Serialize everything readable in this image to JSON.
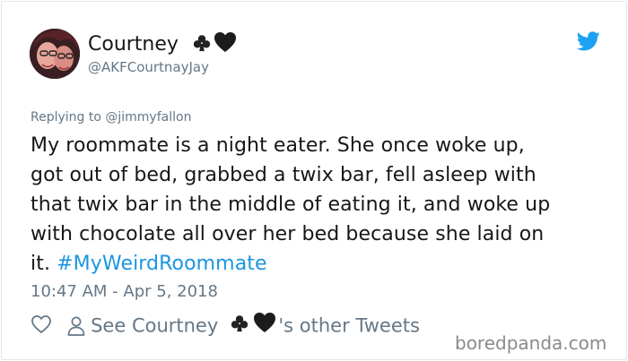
{
  "tweet": {
    "author": {
      "display_name": "Courtney",
      "name_emoji": [
        "club",
        "black-heart"
      ],
      "handle": "@AKFCourtnayJay"
    },
    "replying_to": "Replying to @jimmyfallon",
    "text_lines": [
      "My roommate is a night eater. She once woke up,",
      "got out of bed, grabbed a twix bar, fell asleep with",
      "that twix bar in the middle of eating it, and woke up",
      "with chocolate all over her bed because she laid on",
      "it."
    ],
    "hashtag": "#MyWeirdRoommate",
    "timestamp": "10:47 AM - Apr 5, 2018",
    "actions": {
      "like_icon": "heart-icon",
      "profile_link_prefix": "See Courtney",
      "profile_link_suffix": "'s other Tweets"
    }
  },
  "icons": {
    "brand": "twitter-bird-icon",
    "profile": "person-icon"
  },
  "colors": {
    "link_blue": "#1b95e0",
    "secondary_gray": "#657786",
    "text_dark": "#14171a",
    "twitter_blue": "#1da1f2"
  },
  "watermark": "boredpanda.com"
}
